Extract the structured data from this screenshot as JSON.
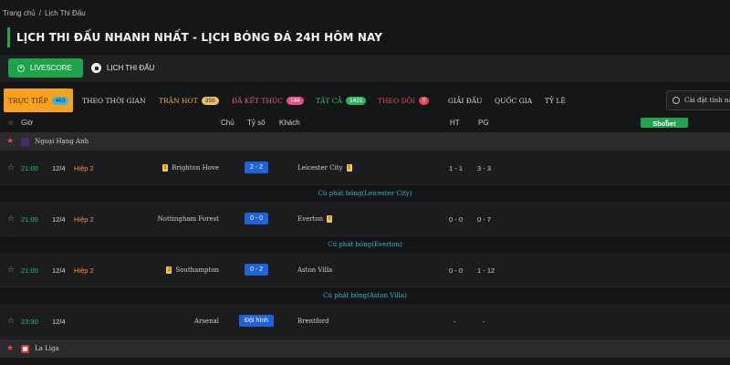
{
  "breadcrumb": {
    "home": "Trang chủ",
    "separator": "/",
    "current": "Lịch Thi Đấu"
  },
  "page_title": "LỊCH THI ĐẤU NHANH NHẤT - LỊCH BÓNG ĐÁ 24H HÔM NAY",
  "modes": {
    "livescore": "LIVESCORE",
    "schedule": "LỊCH THI ĐẤU"
  },
  "tabs": [
    {
      "label": "TRỰC TIẾP",
      "count": "463"
    },
    {
      "label": "THEO THỜI GIAN",
      "count": ""
    },
    {
      "label": "TRẬN HOT",
      "count": "359"
    },
    {
      "label": "ĐÃ KẾT THÚC",
      "count": "144"
    },
    {
      "label": "TẤT CẢ",
      "count": "1431"
    },
    {
      "label": "THEO DÕI",
      "count": "0"
    },
    {
      "label": "GIẢI ĐẤU",
      "count": ""
    },
    {
      "label": "QUỐC GIA",
      "count": ""
    },
    {
      "label": "TỶ LỆ",
      "count": ""
    }
  ],
  "settings_label": "Cài đặt tính năng",
  "columns": {
    "time": "Giờ",
    "home": "Chủ",
    "score": "Tỷ số",
    "away": "Khách",
    "ht": "HT",
    "pg": "PG",
    "bookmaker": "Sbobet"
  },
  "leagues": [
    {
      "name": "Ngoại Hạng Anh"
    },
    {
      "name": "La Liga"
    }
  ],
  "matches": [
    {
      "time": "21:00",
      "date": "12/4",
      "status": "Hiệp 2",
      "home": "Brighton Hove",
      "home_card": "1",
      "score": "2 - 2",
      "away": "Leicester City",
      "away_card": "1",
      "ht": "1 - 1",
      "pg": "3 - 3",
      "corner": "Cú phát bóng(Leicester City)"
    },
    {
      "time": "21:00",
      "date": "12/4",
      "status": "Hiệp 2",
      "home": "Nottingham Forest",
      "home_card": "",
      "score": "0 - 0",
      "away": "Everton",
      "away_card": "1",
      "ht": "0 - 0",
      "pg": "0 - 7",
      "corner": "Cú phát bóng(Everton)"
    },
    {
      "time": "21:00",
      "date": "12/4",
      "status": "Hiệp 2",
      "home": "Southampton",
      "home_card": "2",
      "score": "0 - 2",
      "away": "Aston Villa",
      "away_card": "",
      "ht": "0 - 0",
      "pg": "1 - 12",
      "corner": "Cú phát bóng(Aston Villa)"
    },
    {
      "time": "23:30",
      "date": "12/4",
      "status": "",
      "home": "Arsenal",
      "home_card": "",
      "score": "Đội hình",
      "away": "Brentford",
      "away_card": "",
      "ht": "-",
      "pg": "-",
      "corner": ""
    }
  ],
  "colors": {
    "accent_green": "#1ea34a",
    "live_orange": "#f7a21c",
    "score_blue": "#1e63d9",
    "status_orange": "#ff8a3c",
    "corner_cyan": "#36b7d1"
  }
}
